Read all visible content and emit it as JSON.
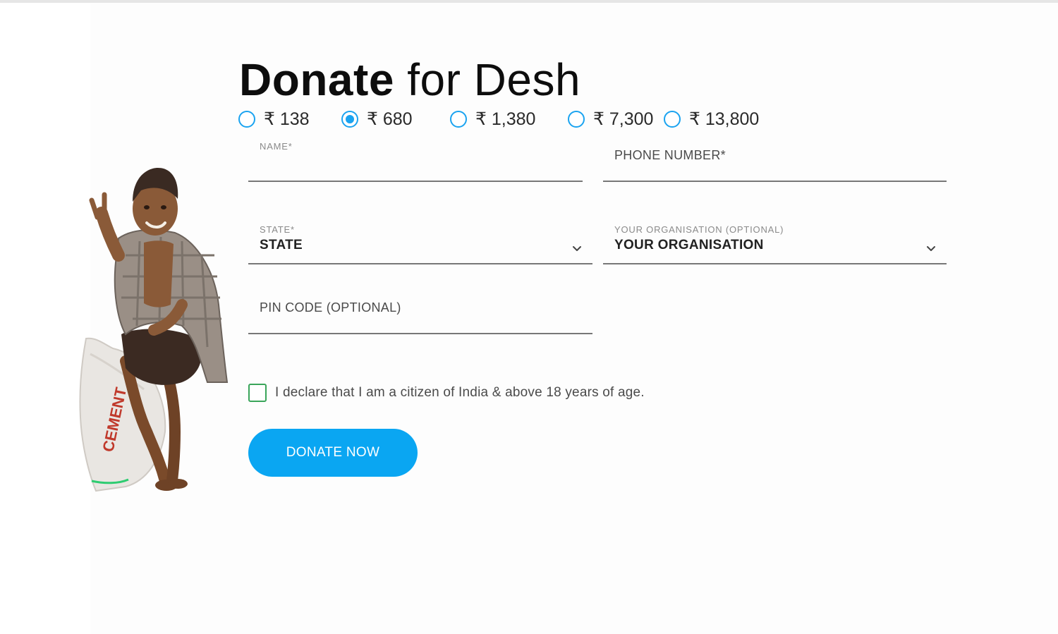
{
  "title": {
    "bold": "Donate",
    "light": "for Desh"
  },
  "amounts": [
    {
      "label": "₹ 138",
      "selected": false
    },
    {
      "label": "₹ 680",
      "selected": true
    },
    {
      "label": "₹ 1,380",
      "selected": false
    },
    {
      "label": "₹ 7,300",
      "selected": false
    },
    {
      "label": "₹ 13,800",
      "selected": false
    }
  ],
  "form": {
    "name": {
      "label": "NAME*",
      "value": ""
    },
    "phone": {
      "label": "PHONE NUMBER*",
      "value": ""
    },
    "state": {
      "label": "STATE*",
      "value": "STATE"
    },
    "organisation": {
      "label": "YOUR ORGANISATION (OPTIONAL)",
      "value": "YOUR ORGANISATION"
    },
    "pincode": {
      "label": "PIN CODE (OPTIONAL)",
      "value": ""
    }
  },
  "declaration": {
    "text": "I declare that I am a citizen of India & above 18 years of age.",
    "checked": false
  },
  "donate_button": {
    "label": "DONATE NOW"
  },
  "colors": {
    "accent": "#0aa6f2",
    "radio": "#1aa3f0",
    "checkbox": "#3aa55a",
    "underline": "#777777"
  },
  "icons": {
    "dropdown": "chevron-down-icon"
  },
  "image": {
    "bag_text": "CEMENT"
  }
}
